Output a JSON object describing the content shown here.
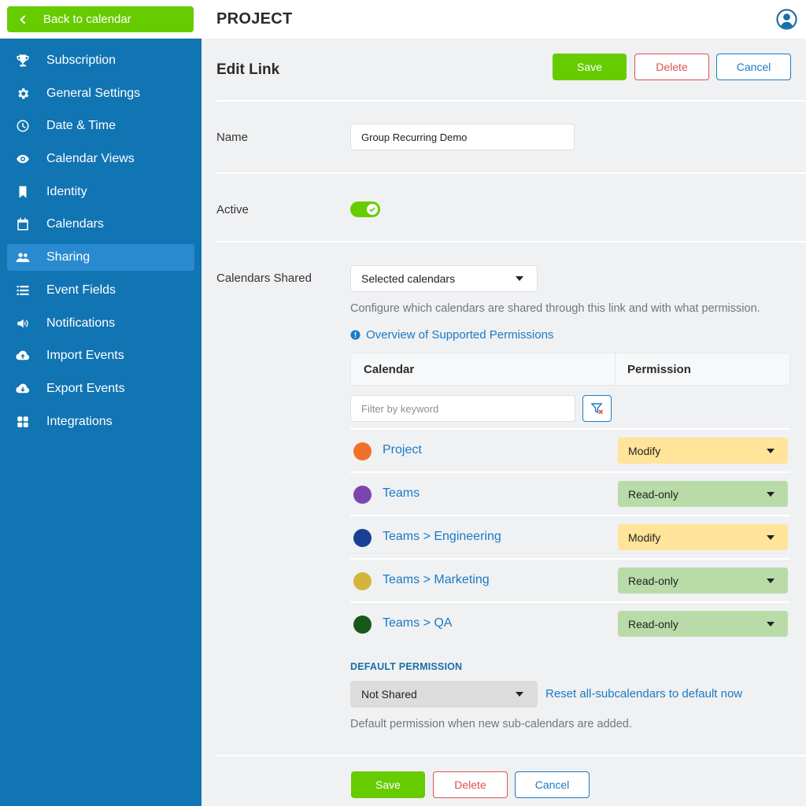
{
  "sidebar": {
    "back_label": "Back to calendar",
    "items": [
      {
        "label": "Subscription",
        "icon": "trophy-icon"
      },
      {
        "label": "General Settings",
        "icon": "gear-icon"
      },
      {
        "label": "Date & Time",
        "icon": "clock-icon"
      },
      {
        "label": "Calendar Views",
        "icon": "eye-icon"
      },
      {
        "label": "Identity",
        "icon": "bookmark-icon"
      },
      {
        "label": "Calendars",
        "icon": "calendar-icon"
      },
      {
        "label": "Sharing",
        "icon": "users-icon",
        "active": true
      },
      {
        "label": "Event Fields",
        "icon": "list-icon"
      },
      {
        "label": "Notifications",
        "icon": "megaphone-icon"
      },
      {
        "label": "Import Events",
        "icon": "cloud-upload-icon"
      },
      {
        "label": "Export Events",
        "icon": "cloud-download-icon"
      },
      {
        "label": "Integrations",
        "icon": "grid-icon"
      }
    ]
  },
  "header": {
    "title": "PROJECT",
    "user_icon": "user-circle-icon"
  },
  "page": {
    "title": "Edit Link",
    "save_label": "Save",
    "delete_label": "Delete",
    "cancel_label": "Cancel"
  },
  "form": {
    "name_label": "Name",
    "name_value": "Group Recurring Demo",
    "active_label": "Active",
    "active_on": true,
    "calendars_shared_label": "Calendars Shared",
    "calendars_shared_value": "Selected calendars",
    "calendars_hint": "Configure which calendars are shared through this link and with what permission.",
    "overview_link": "Overview of Supported Permissions",
    "table": {
      "col_calendar": "Calendar",
      "col_permission": "Permission",
      "filter_placeholder": "Filter by keyword",
      "rows": [
        {
          "name": "Project",
          "color": "#f07029",
          "permission": "Modify"
        },
        {
          "name": "Teams",
          "color": "#7b45b0",
          "permission": "Read-only"
        },
        {
          "name": "Teams > Engineering",
          "color": "#183f93",
          "permission": "Modify"
        },
        {
          "name": "Teams > Marketing",
          "color": "#d4b53c",
          "permission": "Read-only"
        },
        {
          "name": "Teams > QA",
          "color": "#17581b",
          "permission": "Read-only"
        }
      ]
    },
    "default_permission_heading": "DEFAULT PERMISSION",
    "default_permission_value": "Not Shared",
    "reset_link": "Reset all-subcalendars to default now",
    "default_hint": "Default permission when new sub-calendars are added."
  },
  "colors": {
    "sidebar_bg": "#1174b3",
    "accent_green": "#66cc00",
    "link_blue": "#1a7ac4",
    "delete_red": "#d9534f",
    "modify_bg": "#ffe499",
    "readonly_bg": "#b8dba8"
  }
}
